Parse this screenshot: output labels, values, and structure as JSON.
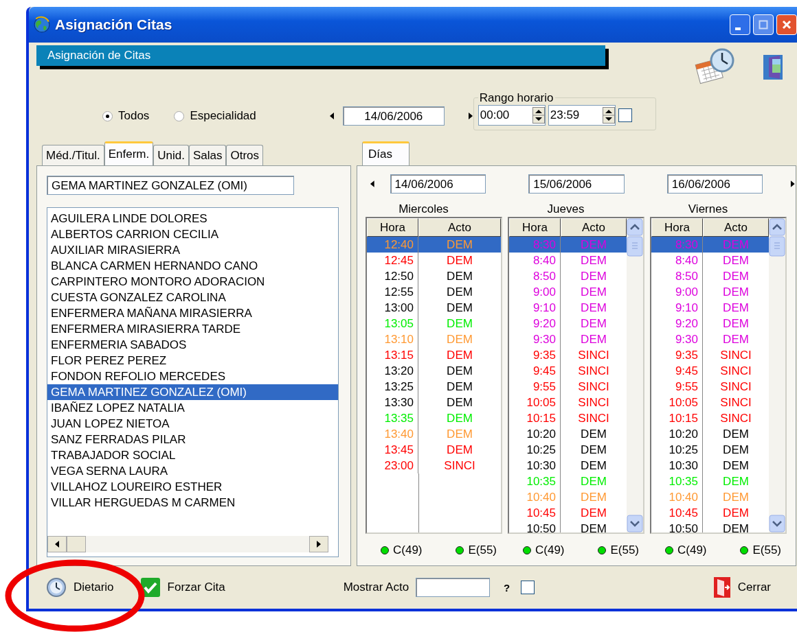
{
  "window": {
    "title": "Asignación Citas"
  },
  "header": {
    "title": "Asignación de Citas"
  },
  "filter": {
    "options": [
      {
        "label": "Todos",
        "selected": true
      },
      {
        "label": "Especialidad",
        "selected": false
      }
    ],
    "date": "14/06/2006"
  },
  "time_range": {
    "legend": "Rango horario",
    "from": "00:00",
    "to": "23:59",
    "checked": false
  },
  "left_tabs": [
    {
      "label": "Méd./Titul.",
      "selected": false
    },
    {
      "label": "Enferm.",
      "selected": true
    },
    {
      "label": "Unid.",
      "selected": false
    },
    {
      "label": "Salas",
      "selected": false
    },
    {
      "label": "Otros",
      "selected": false
    }
  ],
  "name_field": "GEMA MARTINEZ GONZALEZ (OMI)",
  "people": [
    {
      "name": "AGUILERA LINDE DOLORES",
      "selected": false
    },
    {
      "name": "ALBERTOS CARRION CECILIA",
      "selected": false
    },
    {
      "name": "AUXILIAR MIRASIERRA",
      "selected": false
    },
    {
      "name": "BLANCA CARMEN HERNANDO CANO",
      "selected": false
    },
    {
      "name": "CARPINTERO MONTORO ADORACION",
      "selected": false
    },
    {
      "name": "CUESTA GONZALEZ CAROLINA",
      "selected": false
    },
    {
      "name": "ENFERMERA MAÑANA MIRASIERRA",
      "selected": false
    },
    {
      "name": "ENFERMERA MIRASIERRA TARDE",
      "selected": false
    },
    {
      "name": "ENFERMERIA SABADOS",
      "selected": false
    },
    {
      "name": "FLOR PEREZ PEREZ",
      "selected": false
    },
    {
      "name": "FONDON REFOLIO MERCEDES",
      "selected": false
    },
    {
      "name": "GEMA MARTINEZ GONZALEZ (OMI)",
      "selected": true
    },
    {
      "name": "IBAÑEZ LOPEZ NATALIA",
      "selected": false
    },
    {
      "name": "JUAN LOPEZ NIETOA",
      "selected": false
    },
    {
      "name": "SANZ FERRADAS PILAR",
      "selected": false
    },
    {
      "name": "TRABAJADOR SOCIAL",
      "selected": false
    },
    {
      "name": "VEGA SERNA LAURA",
      "selected": false
    },
    {
      "name": "VILLAHOZ LOUREIRO ESTHER",
      "selected": false
    },
    {
      "name": "VILLAR HERGUEDAS M CARMEN",
      "selected": false
    }
  ],
  "days_tab": {
    "label": "Días",
    "selected": true
  },
  "days": [
    {
      "date": "14/06/2006",
      "weekday": "Miercoles",
      "columns": [
        "Hora",
        "Acto"
      ],
      "scrollable": false,
      "rows": [
        {
          "hora": "12:40",
          "acto": "DEM",
          "color": "#ff9933",
          "selected": true
        },
        {
          "hora": "12:45",
          "acto": "DEM",
          "color": "#ff0000",
          "selected": false
        },
        {
          "hora": "12:50",
          "acto": "DEM",
          "color": "#000000",
          "selected": false
        },
        {
          "hora": "12:55",
          "acto": "DEM",
          "color": "#000000",
          "selected": false
        },
        {
          "hora": "13:00",
          "acto": "DEM",
          "color": "#000000",
          "selected": false
        },
        {
          "hora": "13:05",
          "acto": "DEM",
          "color": "#00ee00",
          "selected": false
        },
        {
          "hora": "13:10",
          "acto": "DEM",
          "color": "#ff9933",
          "selected": false
        },
        {
          "hora": "13:15",
          "acto": "DEM",
          "color": "#ff0000",
          "selected": false
        },
        {
          "hora": "13:20",
          "acto": "DEM",
          "color": "#000000",
          "selected": false
        },
        {
          "hora": "13:25",
          "acto": "DEM",
          "color": "#000000",
          "selected": false
        },
        {
          "hora": "13:30",
          "acto": "DEM",
          "color": "#000000",
          "selected": false
        },
        {
          "hora": "13:35",
          "acto": "DEM",
          "color": "#00ee00",
          "selected": false
        },
        {
          "hora": "13:40",
          "acto": "DEM",
          "color": "#ff9933",
          "selected": false
        },
        {
          "hora": "13:45",
          "acto": "DEM",
          "color": "#ff0000",
          "selected": false
        },
        {
          "hora": "23:00",
          "acto": "SINCI",
          "color": "#ff0000",
          "selected": false
        }
      ],
      "legend": [
        {
          "label": "C(49)",
          "color": "#00dd00"
        },
        {
          "label": "E(55)",
          "color": "#00dd00"
        }
      ]
    },
    {
      "date": "15/06/2006",
      "weekday": "Jueves",
      "columns": [
        "Hora",
        "Acto"
      ],
      "scrollable": true,
      "rows": [
        {
          "hora": "8:30",
          "acto": "DEM",
          "color": "#dd00dd",
          "selected": true
        },
        {
          "hora": "8:40",
          "acto": "DEM",
          "color": "#dd00dd",
          "selected": false
        },
        {
          "hora": "8:50",
          "acto": "DEM",
          "color": "#dd00dd",
          "selected": false
        },
        {
          "hora": "9:00",
          "acto": "DEM",
          "color": "#dd00dd",
          "selected": false
        },
        {
          "hora": "9:10",
          "acto": "DEM",
          "color": "#dd00dd",
          "selected": false
        },
        {
          "hora": "9:20",
          "acto": "DEM",
          "color": "#dd00dd",
          "selected": false
        },
        {
          "hora": "9:30",
          "acto": "DEM",
          "color": "#dd00dd",
          "selected": false
        },
        {
          "hora": "9:35",
          "acto": "SINCI",
          "color": "#ff0000",
          "selected": false
        },
        {
          "hora": "9:45",
          "acto": "SINCI",
          "color": "#ff0000",
          "selected": false
        },
        {
          "hora": "9:55",
          "acto": "SINCI",
          "color": "#ff0000",
          "selected": false
        },
        {
          "hora": "10:05",
          "acto": "SINCI",
          "color": "#ff0000",
          "selected": false
        },
        {
          "hora": "10:15",
          "acto": "SINCI",
          "color": "#ff0000",
          "selected": false
        },
        {
          "hora": "10:20",
          "acto": "DEM",
          "color": "#000000",
          "selected": false
        },
        {
          "hora": "10:25",
          "acto": "DEM",
          "color": "#000000",
          "selected": false
        },
        {
          "hora": "10:30",
          "acto": "DEM",
          "color": "#000000",
          "selected": false
        },
        {
          "hora": "10:35",
          "acto": "DEM",
          "color": "#00ee00",
          "selected": false
        },
        {
          "hora": "10:40",
          "acto": "DEM",
          "color": "#ff9933",
          "selected": false
        },
        {
          "hora": "10:45",
          "acto": "DEM",
          "color": "#ff0000",
          "selected": false
        },
        {
          "hora": "10:50",
          "acto": "DEM",
          "color": "#000000",
          "selected": false
        }
      ],
      "legend": [
        {
          "label": "C(49)",
          "color": "#00dd00"
        },
        {
          "label": "E(55)",
          "color": "#00dd00"
        }
      ]
    },
    {
      "date": "16/06/2006",
      "weekday": "Viernes",
      "columns": [
        "Hora",
        "Acto"
      ],
      "scrollable": true,
      "rows": [
        {
          "hora": "8:30",
          "acto": "DEM",
          "color": "#dd00dd",
          "selected": true
        },
        {
          "hora": "8:40",
          "acto": "DEM",
          "color": "#dd00dd",
          "selected": false
        },
        {
          "hora": "8:50",
          "acto": "DEM",
          "color": "#dd00dd",
          "selected": false
        },
        {
          "hora": "9:00",
          "acto": "DEM",
          "color": "#dd00dd",
          "selected": false
        },
        {
          "hora": "9:10",
          "acto": "DEM",
          "color": "#dd00dd",
          "selected": false
        },
        {
          "hora": "9:20",
          "acto": "DEM",
          "color": "#dd00dd",
          "selected": false
        },
        {
          "hora": "9:30",
          "acto": "DEM",
          "color": "#dd00dd",
          "selected": false
        },
        {
          "hora": "9:35",
          "acto": "SINCI",
          "color": "#ff0000",
          "selected": false
        },
        {
          "hora": "9:45",
          "acto": "SINCI",
          "color": "#ff0000",
          "selected": false
        },
        {
          "hora": "9:55",
          "acto": "SINCI",
          "color": "#ff0000",
          "selected": false
        },
        {
          "hora": "10:05",
          "acto": "SINCI",
          "color": "#ff0000",
          "selected": false
        },
        {
          "hora": "10:15",
          "acto": "SINCI",
          "color": "#ff0000",
          "selected": false
        },
        {
          "hora": "10:20",
          "acto": "DEM",
          "color": "#000000",
          "selected": false
        },
        {
          "hora": "10:25",
          "acto": "DEM",
          "color": "#000000",
          "selected": false
        },
        {
          "hora": "10:30",
          "acto": "DEM",
          "color": "#000000",
          "selected": false
        },
        {
          "hora": "10:35",
          "acto": "DEM",
          "color": "#00ee00",
          "selected": false
        },
        {
          "hora": "10:40",
          "acto": "DEM",
          "color": "#ff9933",
          "selected": false
        },
        {
          "hora": "10:45",
          "acto": "DEM",
          "color": "#ff0000",
          "selected": false
        },
        {
          "hora": "10:50",
          "acto": "DEM",
          "color": "#000000",
          "selected": false
        }
      ],
      "legend": [
        {
          "label": "C(49)",
          "color": "#00dd00"
        },
        {
          "label": "E(55)",
          "color": "#00dd00"
        }
      ]
    }
  ],
  "bottom": {
    "dietario": "Dietario",
    "forzar": "Forzar Cita",
    "mostrar_label": "Mostrar Acto",
    "question": "?",
    "checked": false,
    "cerrar": "Cerrar"
  }
}
